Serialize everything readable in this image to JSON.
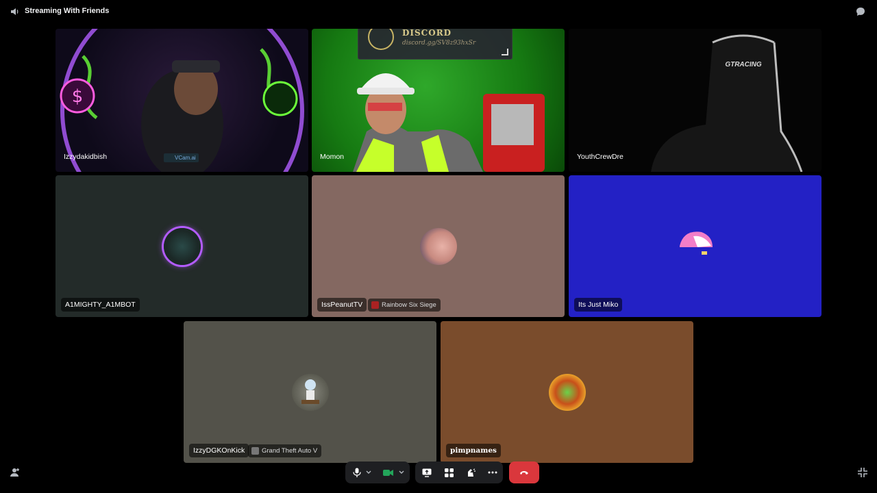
{
  "window": {
    "title": "Streaming With Friends"
  },
  "overlay": {
    "brand": "DISCORD",
    "link": "discord.gg/SV8z93hxSr"
  },
  "tiles": {
    "izzy": {
      "name": "Izzydakidbish",
      "badge": "VCam.ai"
    },
    "momon": {
      "name": "Momon"
    },
    "youth": {
      "name": "YouthCrewDre",
      "chair_text": "GTRACING"
    },
    "a1": {
      "name": "A1MIGHTY_A1MBOT"
    },
    "peanut": {
      "name": "IssPeanutTV",
      "activity": "Rainbow Six Siege"
    },
    "miko": {
      "name": "Its Just Miko"
    },
    "izzydg": {
      "name": "IzzyDGKOnKick",
      "activity": "Grand Theft Auto V"
    },
    "pimp": {
      "name": "pimpnames"
    }
  },
  "controls": {
    "icons": [
      "microphone-icon",
      "chevron-down-icon",
      "camera-icon",
      "chevron-down-icon",
      "screen-share-icon",
      "activities-icon",
      "soundboard-icon",
      "more-icon",
      "hang-up-icon"
    ]
  },
  "colors": {
    "hangup": "#da373c",
    "camera_active": "#23a55a",
    "miko_bg": "#2321c5"
  }
}
